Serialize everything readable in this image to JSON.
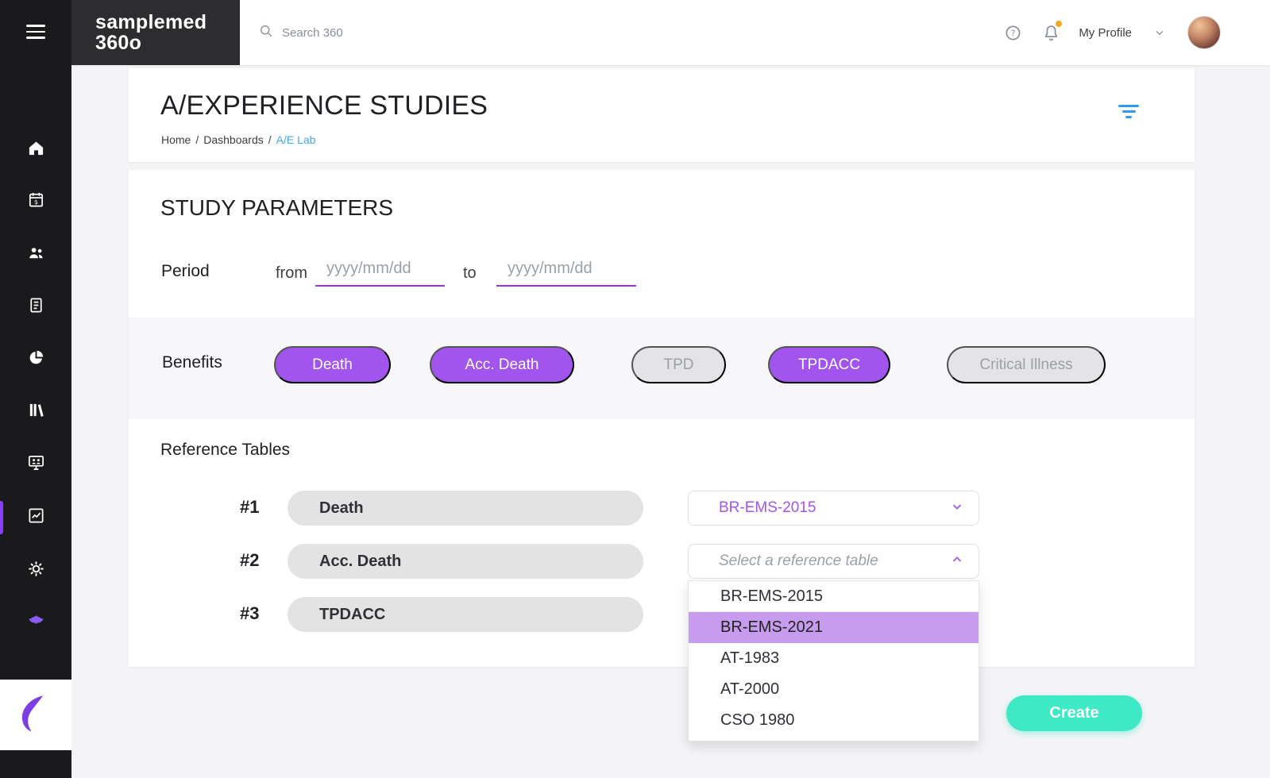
{
  "colors": {
    "accent_purple": "#a155ee",
    "underline_purple": "#9a30ea",
    "teal_create": "#3ee9c6",
    "link_blue": "#3da9f5",
    "filter_blue": "#2e9bf0",
    "highlight_option": "#c79bed",
    "sidebar_bg": "#1a1a1c",
    "notification_dot": "#f5a623"
  },
  "brand": {
    "line1": "samplemed",
    "line2": "360o"
  },
  "header": {
    "search_placeholder": "Search 360",
    "profile_label": "My Profile"
  },
  "sidebar": {
    "items": [
      {
        "name": "menu"
      },
      {
        "name": "home"
      },
      {
        "name": "billing-calendar"
      },
      {
        "name": "users"
      },
      {
        "name": "documents"
      },
      {
        "name": "pie-chart"
      },
      {
        "name": "library"
      },
      {
        "name": "training-screen"
      },
      {
        "name": "analytics",
        "active": true
      },
      {
        "name": "settings"
      },
      {
        "name": "bat"
      }
    ]
  },
  "page": {
    "title": "A/EXPERIENCE STUDIES",
    "breadcrumb": {
      "items": [
        "Home",
        "Dashboards",
        "A/E Lab"
      ],
      "sep": "/"
    }
  },
  "study": {
    "title": "STUDY PARAMETERS",
    "period_label": "Period",
    "from_label": "from",
    "to_label": "to",
    "date_placeholder": "yyyy/mm/dd",
    "benefits_label": "Benefits",
    "benefits": [
      {
        "label": "Death",
        "active": true
      },
      {
        "label": "Acc. Death",
        "active": true
      },
      {
        "label": "TPD",
        "active": false
      },
      {
        "label": "TPDACC",
        "active": true
      },
      {
        "label": "Critical Illness",
        "active": false
      }
    ]
  },
  "reference": {
    "title": "Reference Tables",
    "rows": [
      {
        "index": "#1",
        "benefit": "Death",
        "selected": "BR-EMS-2015"
      },
      {
        "index": "#2",
        "benefit": "Acc. Death",
        "placeholder": "Select a reference table"
      },
      {
        "index": "#3",
        "benefit": "TPDACC"
      }
    ],
    "dropdown": {
      "options": [
        "BR-EMS-2015",
        "BR-EMS-2021",
        "AT-1983",
        "AT-2000",
        "CSO 1980"
      ],
      "highlighted": "BR-EMS-2021"
    }
  },
  "actions": {
    "create_label": "Create"
  }
}
